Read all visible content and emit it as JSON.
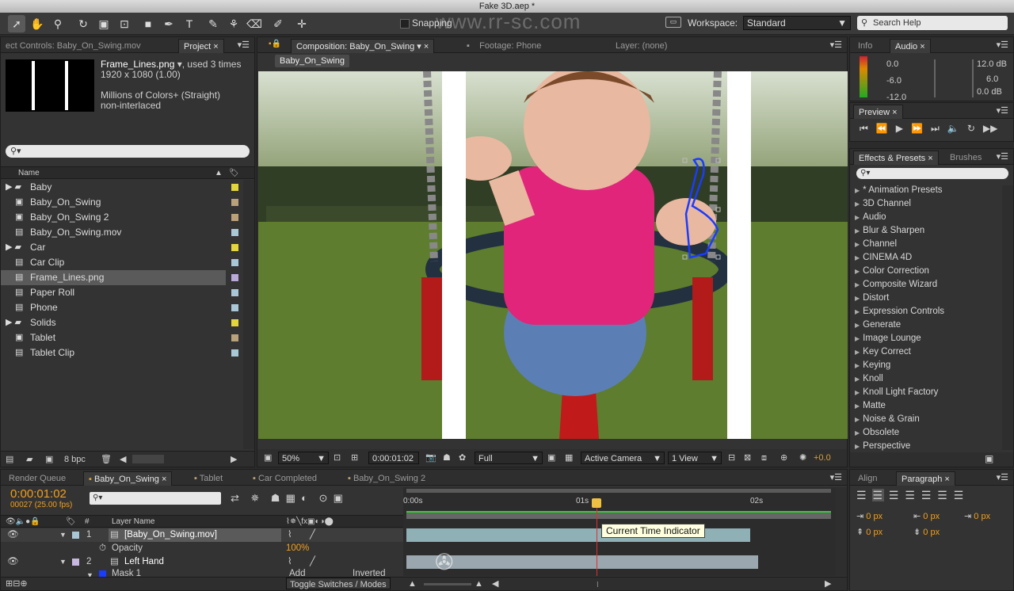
{
  "app": {
    "title": "Fake 3D.aep *"
  },
  "toolbar": {
    "snapping_label": "Snapping",
    "workspace_label": "Workspace:",
    "workspace_value": "Standard",
    "search_placeholder": "Search Help",
    "watermark_url": "www.rr-sc.com"
  },
  "project_panel": {
    "tab_effect_controls": "ect Controls: Baby_On_Swing.mov",
    "tab_project": "Project",
    "selected_name": "Frame_Lines.png",
    "used_times": ", used 3 times",
    "dimensions": "1920 x 1080 (1.00)",
    "colors": "Millions of Colors+ (Straight)",
    "interlace": "non-interlaced",
    "column_name": "Name",
    "bpc": "8 bpc",
    "items": [
      {
        "label": "Baby",
        "type": "folder",
        "color": "#e3d53c"
      },
      {
        "label": "Baby_On_Swing",
        "type": "comp",
        "color": "#b9a27a"
      },
      {
        "label": "Baby_On_Swing 2",
        "type": "comp",
        "color": "#b9a27a"
      },
      {
        "label": "Baby_On_Swing.mov",
        "type": "footage",
        "color": "#a8c8d8"
      },
      {
        "label": "Car",
        "type": "folder",
        "color": "#e3d53c"
      },
      {
        "label": "Car Clip",
        "type": "footage",
        "color": "#a8c8d8"
      },
      {
        "label": "Frame_Lines.png",
        "type": "footage",
        "color": "#b9a8d8"
      },
      {
        "label": "Paper Roll",
        "type": "footage",
        "color": "#a8c8d8"
      },
      {
        "label": "Phone",
        "type": "footage",
        "color": "#a8c8d8"
      },
      {
        "label": "Solids",
        "type": "folder",
        "color": "#e3d53c"
      },
      {
        "label": "Tablet",
        "type": "comp",
        "color": "#b9a27a"
      },
      {
        "label": "Tablet Clip",
        "type": "footage",
        "color": "#a8c8d8"
      }
    ]
  },
  "comp_panel": {
    "tab_comp": "Composition: Baby_On_Swing",
    "tab_footage": "Footage: Phone",
    "tab_layer": "Layer: (none)",
    "breadcrumb": "Baby_On_Swing",
    "zoom": "50%",
    "timecode": "0:00:01:02",
    "resolution": "Full",
    "camera": "Active Camera",
    "views": "1 View",
    "exposure": "+0.0"
  },
  "info_panel": {
    "tab_info": "Info",
    "tab_audio": "Audio",
    "left_levels": [
      "0.0",
      "-6.0",
      "-12.0"
    ],
    "right_levels": [
      "12.0 dB",
      "6.0",
      "0.0 dB"
    ]
  },
  "preview_panel": {
    "tab": "Preview"
  },
  "effects_panel": {
    "tab_effects": "Effects & Presets",
    "tab_brushes": "Brushes",
    "items": [
      "* Animation Presets",
      "3D Channel",
      "Audio",
      "Blur & Sharpen",
      "Channel",
      "CINEMA 4D",
      "Color Correction",
      "Composite Wizard",
      "Distort",
      "Expression Controls",
      "Generate",
      "Image Lounge",
      "Key Correct",
      "Keying",
      "Knoll",
      "Knoll Light Factory",
      "Matte",
      "Noise & Grain",
      "Obsolete",
      "Perspective"
    ]
  },
  "timeline": {
    "tabs": [
      "Render Queue",
      "Baby_On_Swing",
      "Tablet",
      "Car Completed",
      "Baby_On_Swing 2"
    ],
    "current_time": "0:00:01:02",
    "frame_info": "00027 (25.00 fps)",
    "col_layer_name": "Layer Name",
    "ruler": [
      "0:00s",
      "01s",
      "02s"
    ],
    "tooltip": "Current Time Indicator",
    "toggle_label": "Toggle Switches / Modes",
    "layers": [
      {
        "num": "1",
        "name": "[Baby_On_Swing.mov]"
      },
      {
        "num": "",
        "name": "Opacity",
        "value": "100%"
      },
      {
        "num": "2",
        "name": "Left Hand"
      },
      {
        "num": "",
        "name": "Mask 1",
        "mode": "Add",
        "inv": "Inverted"
      }
    ]
  },
  "paragraph_panel": {
    "tab_align": "Align",
    "tab_paragraph": "Paragraph",
    "fields": [
      "0 px",
      "0 px",
      "0 px",
      "0 px",
      "0 px"
    ]
  },
  "colors": {
    "accent_orange": "#f0a020",
    "mask_blue": "#1a3cff",
    "ui_bg": "#333333"
  }
}
